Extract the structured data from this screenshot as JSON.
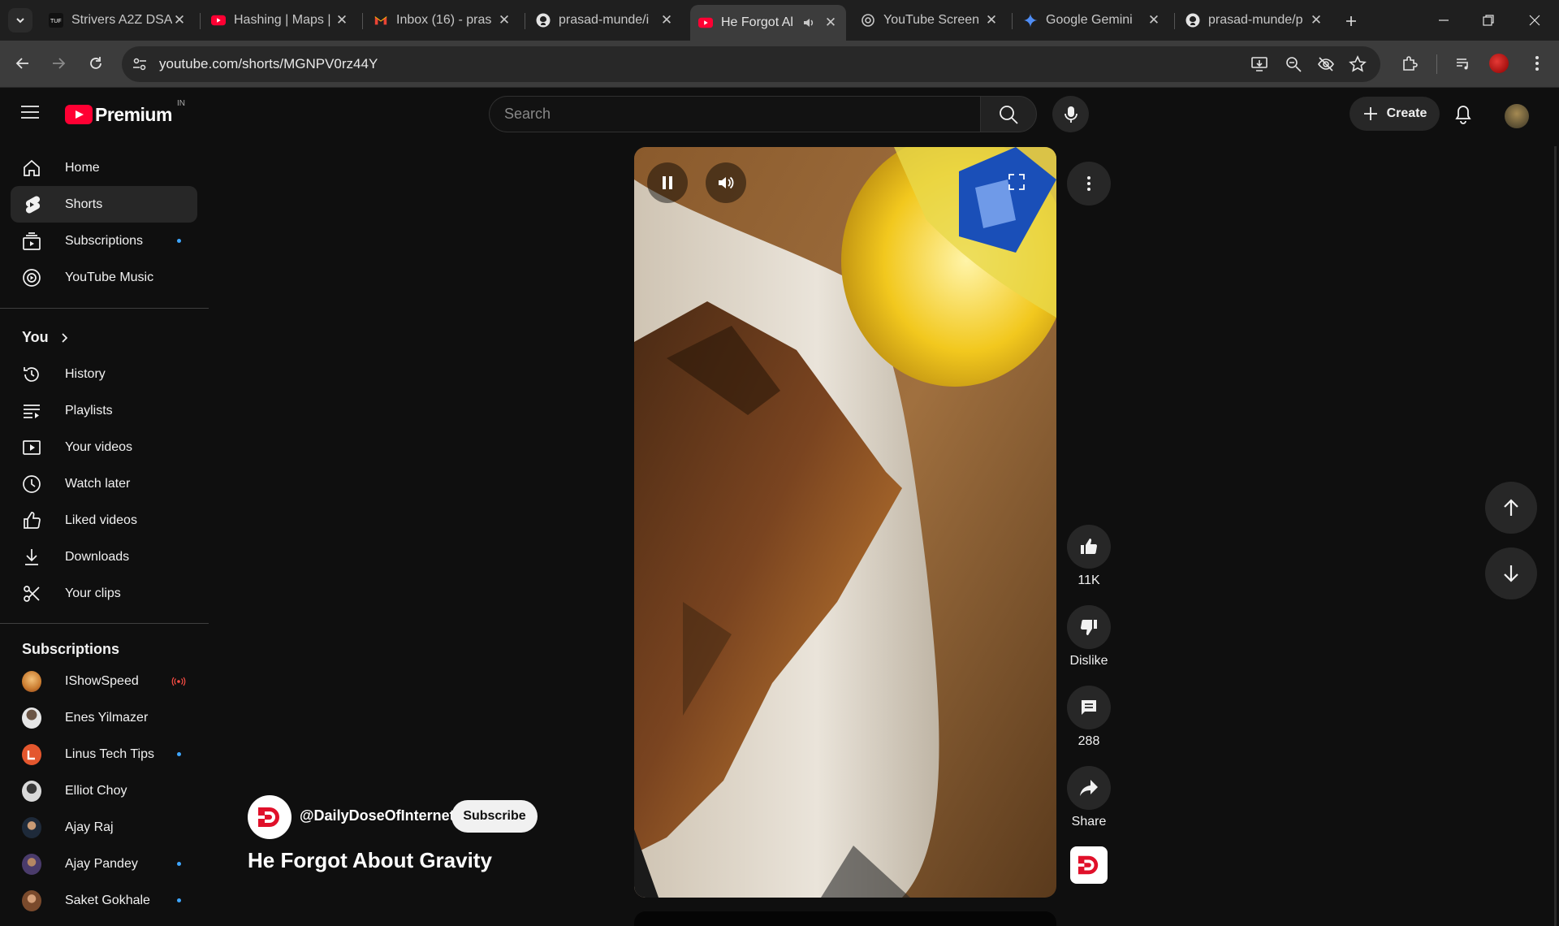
{
  "browser": {
    "tabs": [
      {
        "title": "Strivers A2Z DSA",
        "favicon": "tuf-icon"
      },
      {
        "title": "Hashing | Maps |",
        "favicon": "youtube-icon"
      },
      {
        "title": "Inbox (16) - pras",
        "favicon": "gmail-icon"
      },
      {
        "title": "prasad-munde/i",
        "favicon": "github-icon"
      },
      {
        "title": "He Forgot Al",
        "favicon": "youtube-icon",
        "active": true,
        "audio": true
      },
      {
        "title": "YouTube Screen",
        "favicon": "openai-icon"
      },
      {
        "title": "Google Gemini",
        "favicon": "gemini-icon"
      },
      {
        "title": "prasad-munde/p",
        "favicon": "github-icon"
      }
    ],
    "url": "youtube.com/shorts/MGNPV0rz44Y"
  },
  "youtube": {
    "logo_text": "Premium",
    "country_code": "IN",
    "search_placeholder": "Search",
    "create_label": "Create",
    "nav": [
      {
        "label": "Home",
        "icon": "home-icon"
      },
      {
        "label": "Shorts",
        "icon": "shorts-icon",
        "active": true
      },
      {
        "label": "Subscriptions",
        "icon": "subscriptions-icon",
        "dot": true
      },
      {
        "label": "YouTube Music",
        "icon": "youtube-music-icon"
      }
    ],
    "you_heading": "You",
    "you_items": [
      {
        "label": "History",
        "icon": "history-icon"
      },
      {
        "label": "Playlists",
        "icon": "playlists-icon"
      },
      {
        "label": "Your videos",
        "icon": "your-videos-icon"
      },
      {
        "label": "Watch later",
        "icon": "watch-later-icon"
      },
      {
        "label": "Liked videos",
        "icon": "liked-videos-icon"
      },
      {
        "label": "Downloads",
        "icon": "downloads-icon"
      },
      {
        "label": "Your clips",
        "icon": "clips-icon"
      }
    ],
    "subscriptions_heading": "Subscriptions",
    "subscriptions": [
      {
        "name": "IShowSpeed",
        "live": true,
        "color": "#c97b2f"
      },
      {
        "name": "Enes Yilmazer",
        "color": "#e6e6e6"
      },
      {
        "name": "Linus Tech Tips",
        "dot": true,
        "color": "#e4572e"
      },
      {
        "name": "Elliot Choy",
        "color": "#d9d9d9"
      },
      {
        "name": "Ajay Raj",
        "color": "#5a4a3a"
      },
      {
        "name": "Ajay Pandey",
        "dot": true,
        "color": "#6b4f3a"
      },
      {
        "name": "Saket Gokhale",
        "dot": true,
        "color": "#8a5a3c"
      }
    ],
    "short": {
      "title": "He Forgot About Gravity",
      "channel": "@DailyDoseOfInternet",
      "subscribe_label": "Subscribe",
      "likes": "11K",
      "dislike_label": "Dislike",
      "comments": "288",
      "share_label": "Share"
    },
    "colors": {
      "brand_red": "#ff0033",
      "accent_blue": "#3ea6ff",
      "live_red": "#ff4e45"
    }
  }
}
